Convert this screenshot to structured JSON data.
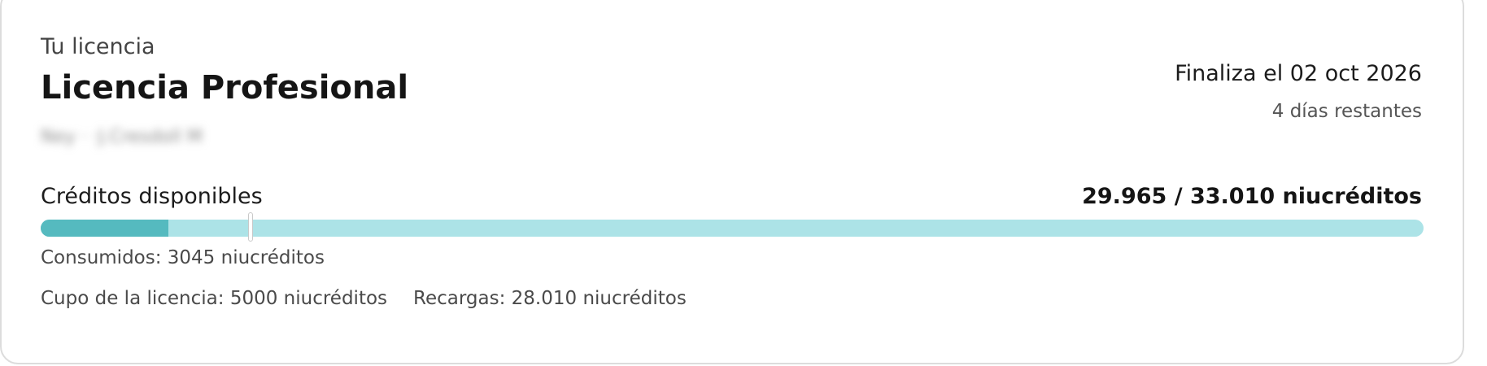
{
  "license": {
    "eyebrow": "Tu licencia",
    "title": "Licencia Profesional",
    "masked_identifier": "Ney ·  ·J.Cresdoll M",
    "expiry": "Finaliza el 02 oct 2026",
    "remaining": "4 días restantes"
  },
  "credits": {
    "label": "Créditos disponibles",
    "available_total": "29.965 / 33.010 niucréditos",
    "consumed_text": "Consumidos: 3045 niucréditos",
    "quota_text": "Cupo de la licencia: 5000 niucréditos",
    "recharges_text": "Recargas: 28.010 niucréditos",
    "progress": {
      "consumed_fraction": 0.0922,
      "license_quota_fraction": 0.1515
    }
  },
  "colors": {
    "bar_track": "#ace3e7",
    "bar_fill": "#55babf",
    "card_border": "#dcdcdc"
  }
}
